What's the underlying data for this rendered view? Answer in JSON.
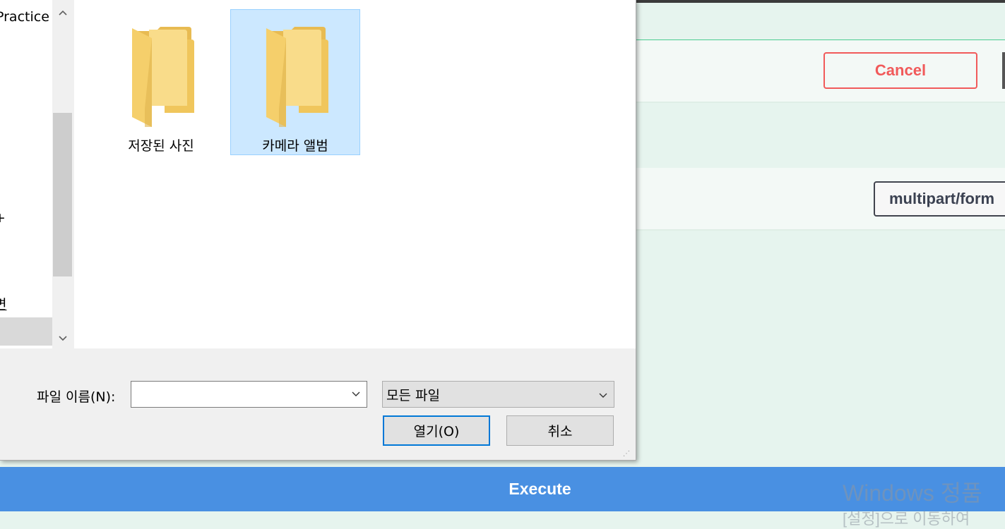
{
  "background_app": {
    "cancel_label": "Cancel",
    "content_type_value": "multipart/form",
    "execute_label": "Execute"
  },
  "watermark": {
    "title": "Windows 정품",
    "subtitle": "[설정]으로 이동하여"
  },
  "dialog": {
    "nav": {
      "items": [
        {
          "label": "Practice"
        },
        {
          "label": "+"
        },
        {
          "label": "변"
        }
      ]
    },
    "folders": [
      {
        "label": "저장된 사진",
        "selected": false
      },
      {
        "label": "카메라 앨범",
        "selected": true
      }
    ],
    "filename": {
      "label": "파일 이름(N):",
      "value": ""
    },
    "file_type": {
      "selected": "모든 파일"
    },
    "buttons": {
      "open": "열기(O)",
      "cancel": "취소"
    }
  },
  "colors": {
    "background": "#e6f4ee",
    "execute_blue": "#4990e2",
    "cancel_red": "#f15a5a",
    "selection_blue": "#cce8ff",
    "folder_yellow": "#f5cf6b"
  },
  "icons": {
    "folder": "folder-icon",
    "scroll_up": "chevron-up-icon",
    "scroll_down": "chevron-down-icon",
    "dropdown": "chevron-down-icon"
  }
}
